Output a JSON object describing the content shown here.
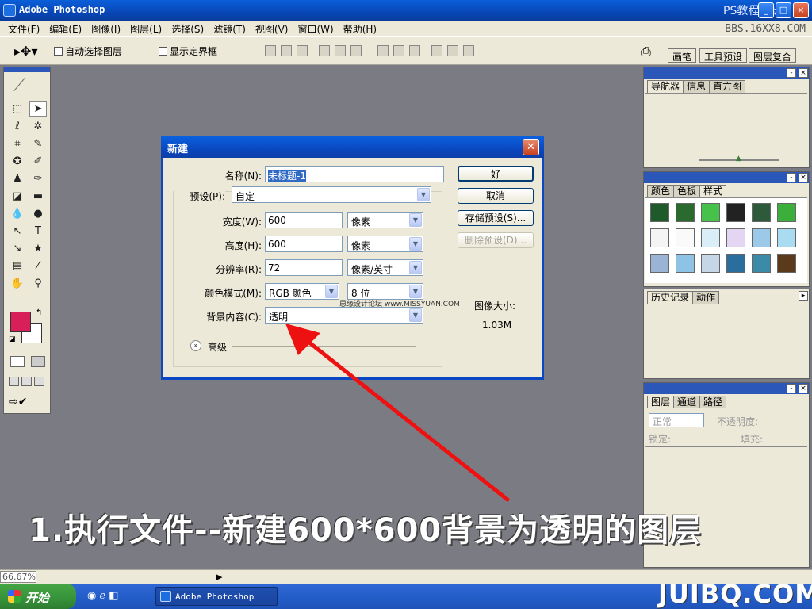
{
  "window": {
    "title": "Adobe Photoshop",
    "watermark_top": "PS教程论坛",
    "bbs_text": "BBS.16XX8.COM"
  },
  "menu": [
    "文件(F)",
    "编辑(E)",
    "图像(I)",
    "图层(L)",
    "选择(S)",
    "滤镜(T)",
    "视图(V)",
    "窗口(W)",
    "帮助(H)"
  ],
  "options": {
    "auto_select": "自动选择图层",
    "show_bounds": "显示定界框",
    "well_tabs": [
      "画笔",
      "工具预设",
      "图层复合"
    ]
  },
  "dialog": {
    "title": "新建",
    "name_label": "名称(N):",
    "name_value": "未标题-1",
    "preset_label": "预设(P):",
    "preset_value": "自定",
    "width_label": "宽度(W):",
    "width_value": "600",
    "width_unit": "像素",
    "height_label": "高度(H):",
    "height_value": "600",
    "height_unit": "像素",
    "res_label": "分辨率(R):",
    "res_value": "72",
    "res_unit": "像素/英寸",
    "mode_label": "颜色模式(M):",
    "mode_value": "RGB 颜色",
    "bits_value": "8 位",
    "bg_label": "背景内容(C):",
    "bg_value": "透明",
    "advanced_label": "高级",
    "ok_label": "好",
    "cancel_label": "取消",
    "save_preset_label": "存储预设(S)...",
    "delete_preset_label": "删除预设(D)...",
    "image_size_label": "图像大小:",
    "image_size_value": "1.03M",
    "inline_watermark": "思缘设计论坛 www.MISSYUAN.COM"
  },
  "panels": {
    "nav_tabs": [
      "导航器",
      "信息",
      "直方图"
    ],
    "color_tabs": [
      "颜色",
      "色板",
      "样式"
    ],
    "history_tabs": [
      "历史记录",
      "动作"
    ],
    "layers_tabs": [
      "图层",
      "通道",
      "路径"
    ],
    "blend_mode": "正常",
    "opacity_label": "不透明度:",
    "lock_label": "锁定:",
    "fill_label": "填充:"
  },
  "status": {
    "zoom": "66.67%"
  },
  "taskbar": {
    "start_label": "开始",
    "app_label": "Adobe Photoshop"
  },
  "caption": "1.执行文件--新建600*600背景为透明的图层",
  "bottom_watermark": "JUIBQ.COM",
  "colors": {
    "foreground": "#d81f5a",
    "background": "#ffffff",
    "accent": "#0a47c2"
  }
}
